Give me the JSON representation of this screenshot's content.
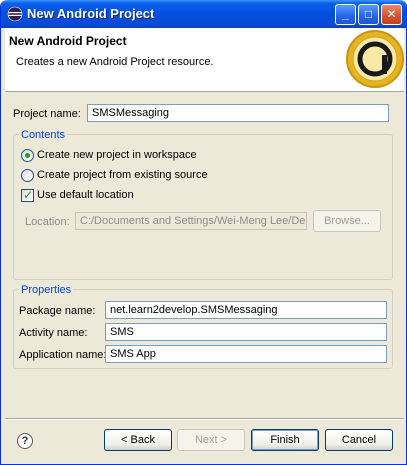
{
  "window": {
    "title": "New Android Project",
    "icon": "eclipse-icon",
    "controls": {
      "minimize": "_",
      "maximize": "□",
      "close": "✕"
    }
  },
  "header": {
    "title": "New Android Project",
    "description": "Creates a new Android Project resource.",
    "badge_letter": "a"
  },
  "project": {
    "name_label": "Project name:",
    "name_value": "SMSMessaging"
  },
  "contents": {
    "legend": "Contents",
    "create_new_label": "Create new project in workspace",
    "create_existing_label": "Create project from existing source",
    "use_default_label": "Use default location",
    "location_label": "Location:",
    "location_value": "C:/Documents and Settings/Wei-Meng Lee/Desktop",
    "browse_label": "Browse..."
  },
  "properties": {
    "legend": "Properties",
    "package_label": "Package name:",
    "package_value": "net.learn2develop.SMSMessaging",
    "activity_label": "Activity name:",
    "activity_value": "SMS",
    "application_label": "Application name:",
    "application_value": "SMS App"
  },
  "buttons": {
    "help": "?",
    "back": "< Back",
    "next": "Next >",
    "finish": "Finish",
    "cancel": "Cancel"
  },
  "colors": {
    "title_bar": "#0350e0",
    "dialog_bg": "#ece9d8",
    "group_legend": "#0046d5",
    "badge_gold": "#e6b422"
  }
}
